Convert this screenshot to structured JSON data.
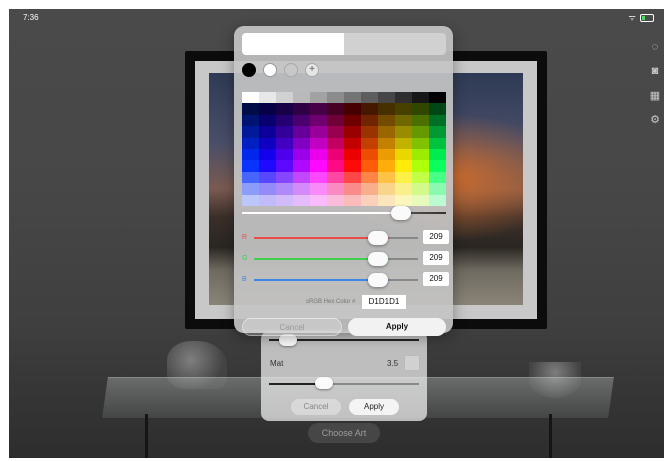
{
  "status_bar": {
    "time": "7:36"
  },
  "side_tools": [
    "lightbulb-icon",
    "camera-icon",
    "grid-icon",
    "gear-icon"
  ],
  "choose_art_label": "Choose Art",
  "frame_settings": {
    "mat_label": "Mat",
    "mat_value": "3.5",
    "mat_color": "#D1D1D1",
    "mat_width_fraction": 0.35,
    "cancel_label": "Cancel",
    "apply_label": "Apply"
  },
  "color_picker": {
    "preview_new": "#FFFFFF",
    "preview_current": "#D1D1D1",
    "presets": [
      "#000000",
      "#FFFFFF",
      "#C8C8C8"
    ],
    "brightness_fraction": 0.78,
    "channels": [
      {
        "name": "R",
        "value": "209",
        "color": "#e84c4c"
      },
      {
        "name": "G",
        "value": "209",
        "color": "#3fcf4f"
      },
      {
        "name": "B",
        "value": "209",
        "color": "#3f84e8"
      }
    ],
    "hex_label": "sRGB Hex Color #",
    "hex_value": "D1D1D1",
    "cancel_label": "Cancel",
    "apply_label": "Apply"
  }
}
